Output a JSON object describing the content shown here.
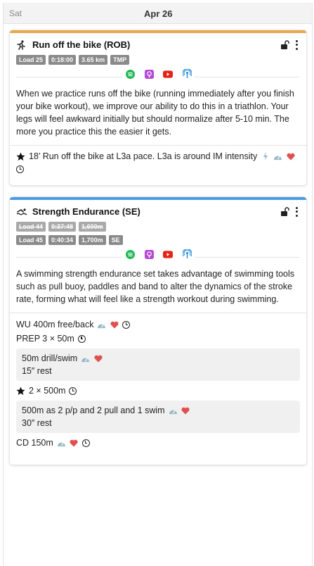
{
  "header": {
    "day_name": "Sat",
    "date": "Apr 26"
  },
  "colors": {
    "run_accent": "#e5a94a",
    "swim_accent": "#4a9be5",
    "badge": "#8a8a8a",
    "heart": "#e05050",
    "gauge": "#9ab8c8"
  },
  "cards": [
    {
      "title": "Run off the bike (ROB)",
      "sport_icon": "runner-icon",
      "badges": [
        "Load 25",
        "0:18:00",
        "3.65 km",
        "TMP"
      ],
      "media_icons": [
        "spotify-icon",
        "podcast-app-icon",
        "youtube-icon",
        "podcast-icon"
      ],
      "description": "When we practice runs off the bike (running immediately after you finish your bike workout), we improve our ability to do this in a triathlon. Your legs will feel awkward initially but should normalize after 5-10 min. The more you practice this the easier it gets.",
      "main_set": "18’ Run off the bike at L3a pace. L3a is around IM intensity"
    },
    {
      "title": "Strength Endurance (SE)",
      "sport_icon": "swimmer-icon",
      "badges_old": [
        "Load 44",
        "0:37:48",
        "1,600m"
      ],
      "badges": [
        "Load 45",
        "0:40:34",
        "1,700m",
        "SE"
      ],
      "media_icons": [
        "spotify-icon",
        "podcast-app-icon",
        "youtube-icon",
        "podcast-icon"
      ],
      "description": "A swimming strength endurance set takes advantage of swimming tools such as pull buoy, paddles and band to alter the dynamics of the stroke rate, forming what will feel like a strength workout during swimming.",
      "warmup": "WU 400m free/back",
      "prep": "PREP 3 × 50m",
      "prep_detail": "50m drill/swim",
      "prep_rest": "15″ rest",
      "main": "2 × 500m",
      "main_detail": "500m as 2 p/p and 2 pull and 1 swim",
      "main_rest": "30″ rest",
      "cooldown": "CD 150m"
    }
  ]
}
